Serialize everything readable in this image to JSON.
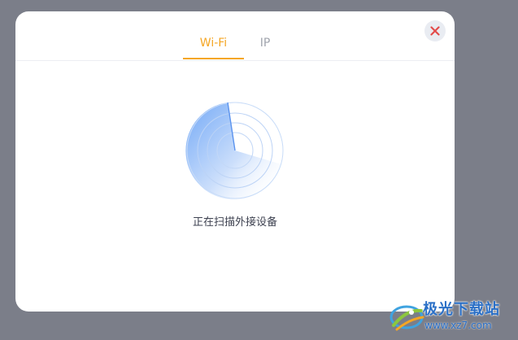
{
  "dialog": {
    "tabs": [
      {
        "label": "Wi-Fi",
        "active": true
      },
      {
        "label": "IP",
        "active": false
      }
    ],
    "status_text": "正在扫描外接设备",
    "close_icon": "close-icon",
    "scan_icon": "radar-scan-icon"
  },
  "watermark": {
    "title": "极光下载站",
    "url": "www.xz7.com"
  },
  "colors": {
    "accent": "#f5a623",
    "close": "#e24b4b",
    "radar": "#6fa8f5",
    "overlay": "#7b7e89"
  }
}
